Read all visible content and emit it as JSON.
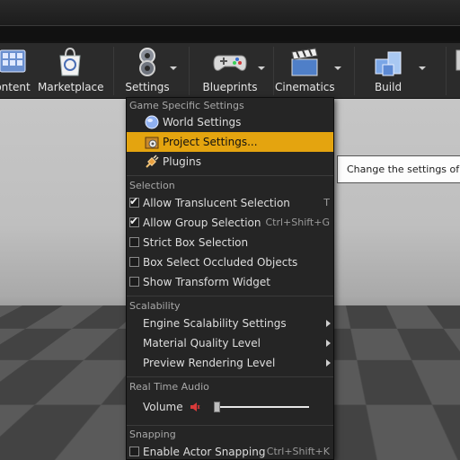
{
  "toolbar": {
    "buttons": [
      {
        "label": "ontent",
        "icon": "content-browser-icon"
      },
      {
        "label": "Marketplace",
        "icon": "marketplace-icon"
      },
      {
        "label": "Settings",
        "icon": "settings-gears-icon"
      },
      {
        "label": "Blueprints",
        "icon": "blueprints-gamepad-icon"
      },
      {
        "label": "Cinematics",
        "icon": "cinematics-clapper-icon"
      },
      {
        "label": "Build",
        "icon": "build-cubes-icon"
      }
    ]
  },
  "menu": {
    "sections": {
      "game_specific": "Game Specific Settings",
      "selection": "Selection",
      "scalability": "Scalability",
      "real_time_audio": "Real Time Audio",
      "snapping": "Snapping"
    },
    "game_items": [
      {
        "label": "World Settings",
        "icon": "world-globe-icon"
      },
      {
        "label": "Project Settings...",
        "icon": "project-settings-icon",
        "highlighted": true
      },
      {
        "label": "Plugins",
        "icon": "plugin-plug-icon"
      }
    ],
    "selection_items": [
      {
        "label": "Allow Translucent Selection",
        "checked": true,
        "shortcut": "T"
      },
      {
        "label": "Allow Group Selection",
        "checked": true,
        "shortcut": "Ctrl+Shift+G"
      },
      {
        "label": "Strict Box Selection",
        "checked": false,
        "shortcut": ""
      },
      {
        "label": "Box Select Occluded Objects",
        "checked": false,
        "shortcut": ""
      },
      {
        "label": "Show Transform Widget",
        "checked": false,
        "shortcut": ""
      }
    ],
    "scalability_items": [
      {
        "label": "Engine Scalability Settings"
      },
      {
        "label": "Material Quality Level"
      },
      {
        "label": "Preview Rendering Level"
      }
    ],
    "audio": {
      "volume_label": "Volume",
      "volume_level": 0.0
    },
    "snapping_items": [
      {
        "label": "Enable Actor Snapping",
        "checked": false,
        "shortcut": "Ctrl+Shift+K"
      }
    ]
  },
  "tooltip": {
    "text": "Change the settings of the currently loaded project"
  },
  "colors": {
    "highlight": "#e4a40f",
    "menu_bg": "#252525",
    "toolbar_bg": "#2b2b2b"
  }
}
